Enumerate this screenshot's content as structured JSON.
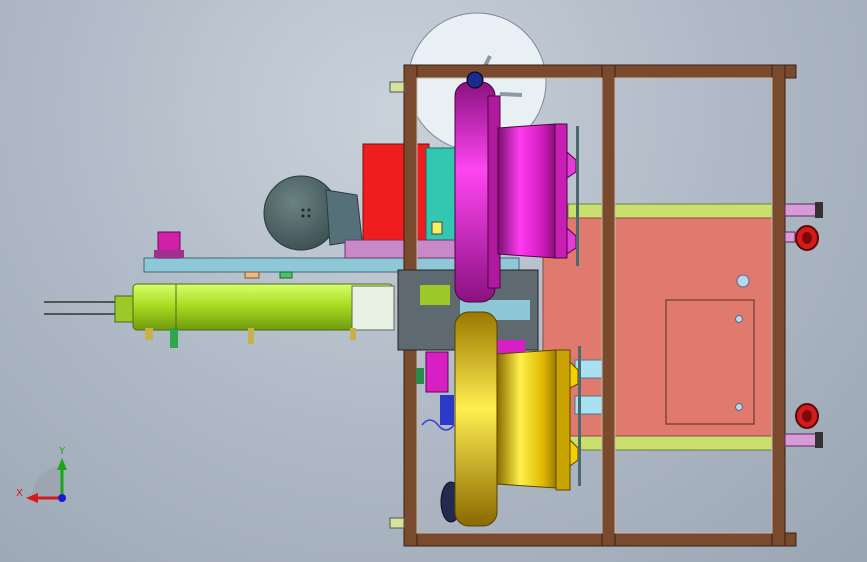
{
  "viewport": {
    "background_top": "#c9d1db",
    "background_bottom": "#9aa5b3"
  },
  "triad": {
    "x_label": "X",
    "y_label": "Y",
    "x_color": "#d41a1a",
    "y_color": "#1aa61a",
    "z_color": "#1a1ad4"
  },
  "colors": {
    "frame": "#7a4a2e",
    "magenta": "#d81fc4",
    "yellow": "#e6c200",
    "lime": "#b8e83a",
    "salmon": "#e07a6e",
    "red_box": "#ef1d1d",
    "teal": "#33c6b0",
    "plate": "#8ec7d6",
    "disk": "#4f6668"
  }
}
